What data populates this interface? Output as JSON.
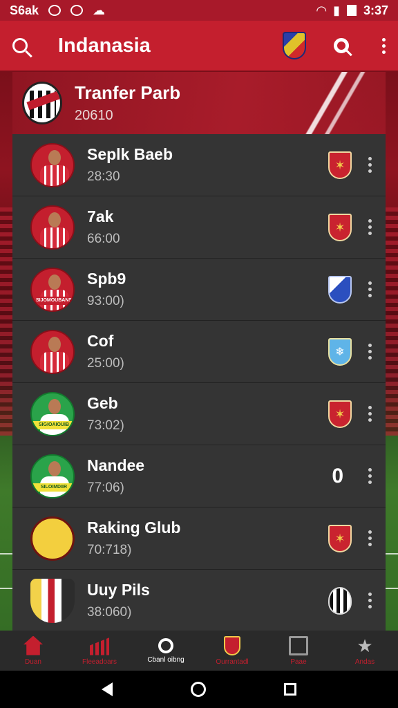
{
  "status": {
    "carrier": "S6ak",
    "time": "3:37"
  },
  "appbar": {
    "title": "Indanasia"
  },
  "header": {
    "title": "Tranfer Parb",
    "subtitle": "20610"
  },
  "items": [
    {
      "name": "Seplk Baeb",
      "sub": "28:30",
      "avatar": "red",
      "crest": "red",
      "score": ""
    },
    {
      "name": "7ak",
      "sub": "66:00",
      "avatar": "red",
      "crest": "red",
      "score": ""
    },
    {
      "name": "Spb9",
      "sub": "93:00)",
      "avatar": "red",
      "plate": "SIJOMOUBANS",
      "crest": "blue",
      "score": ""
    },
    {
      "name": "Cof",
      "sub": "25:00)",
      "avatar": "red",
      "crest": "sky",
      "score": ""
    },
    {
      "name": "Geb",
      "sub": "73:02)",
      "avatar": "green",
      "plate": "SIGIOAIOUIB",
      "crest": "red",
      "score": ""
    },
    {
      "name": "Nandee",
      "sub": "77:06)",
      "avatar": "green",
      "plate": "SILOIMDIIR",
      "crest": "",
      "score": "0"
    },
    {
      "name": "Raking Glub",
      "sub": "70:718)",
      "avatar": "gold",
      "crest": "red",
      "score": ""
    },
    {
      "name": "Uuy Pils",
      "sub": "38:060)",
      "avatar": "badge",
      "crest": "bw",
      "score": ""
    }
  ],
  "nav": [
    {
      "label": "Duan",
      "icon": "home-icon"
    },
    {
      "label": "Fleeadoars",
      "icon": "stats-icon"
    },
    {
      "label": "Cbanl oibng",
      "icon": "search-icon"
    },
    {
      "label": "Ourrantadl",
      "icon": "crest-icon"
    },
    {
      "label": "Paae",
      "icon": "page-icon"
    },
    {
      "label": "Andas",
      "icon": "star-icon"
    }
  ]
}
